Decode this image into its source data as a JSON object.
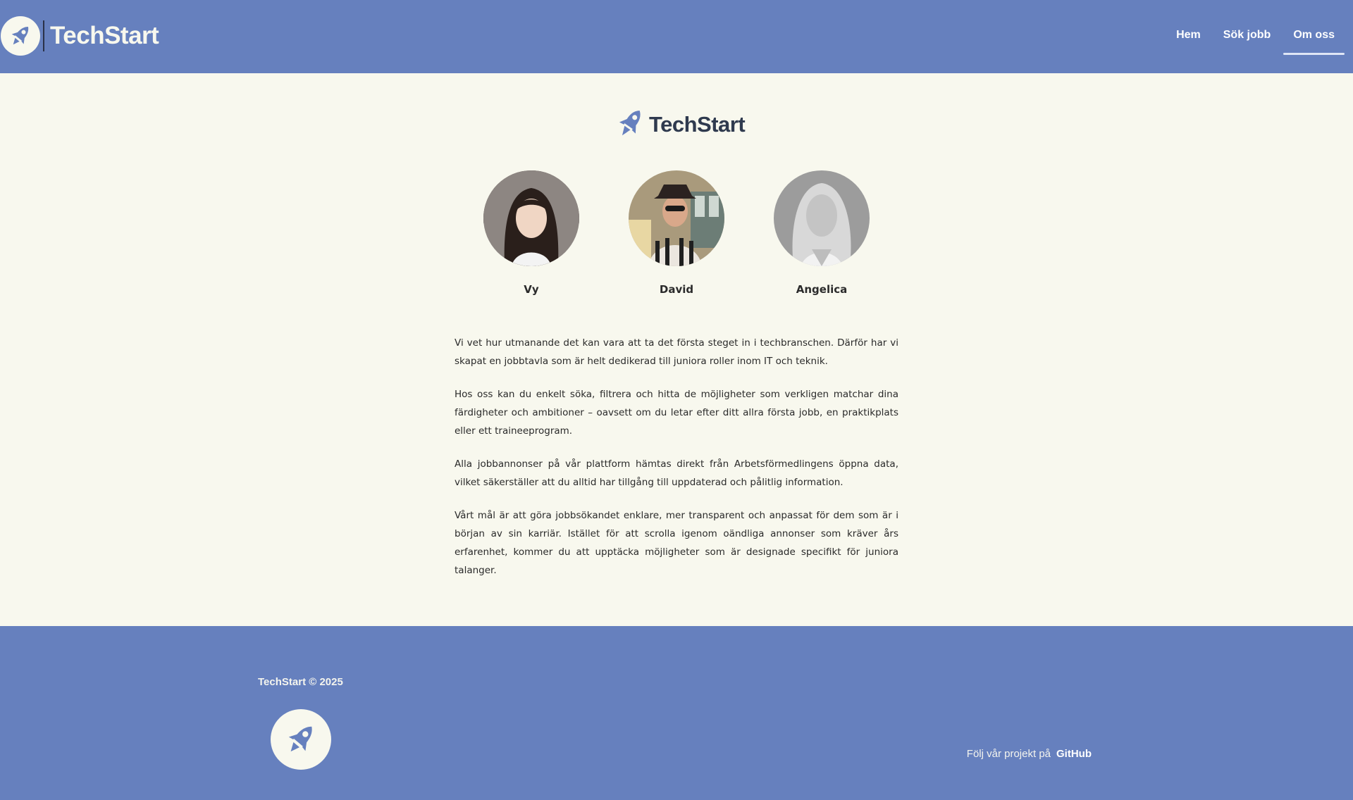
{
  "header": {
    "brand": "TechStart",
    "nav": [
      {
        "label": "Hem",
        "active": false
      },
      {
        "label": "Sök jobb",
        "active": false
      },
      {
        "label": "Om oss",
        "active": true
      }
    ]
  },
  "hero": {
    "brand": "TechStart"
  },
  "team": [
    {
      "name": "Vy"
    },
    {
      "name": "David"
    },
    {
      "name": "Angelica"
    }
  ],
  "about": {
    "paragraphs": [
      "Vi vet hur utmanande det kan vara att ta det första steget in i techbranschen. Därför har vi skapat en jobbtavla som är helt dedikerad till juniora roller inom IT och teknik.",
      "Hos oss kan du enkelt söka, filtrera och hitta de möjligheter som verkligen matchar dina färdigheter och ambitioner – oavsett om du letar efter ditt allra första jobb, en praktikplats eller ett traineeprogram.",
      "Alla jobbannonser på vår plattform hämtas direkt från Arbetsförmedlingens öppna data, vilket säkerställer att du alltid har tillgång till uppdaterad och pålitlig information.",
      "Vårt mål är att göra jobbsökandet enklare, mer transparent och anpassat för dem som är i början av sin karriär. Istället för att scrolla igenom oändliga annonser som kräver års erfarenhet, kommer du att upptäcka möjligheter som är designade specifikt för juniora talanger."
    ]
  },
  "footer": {
    "copyright": "TechStart © 2025",
    "follow_text": "Följ vår projekt på",
    "github_label": "GitHub"
  },
  "colors": {
    "primary": "#6680be",
    "background": "#f8f8ee",
    "text_dark": "#2f3a4e"
  },
  "icons": {
    "brand": "rocket-icon"
  }
}
